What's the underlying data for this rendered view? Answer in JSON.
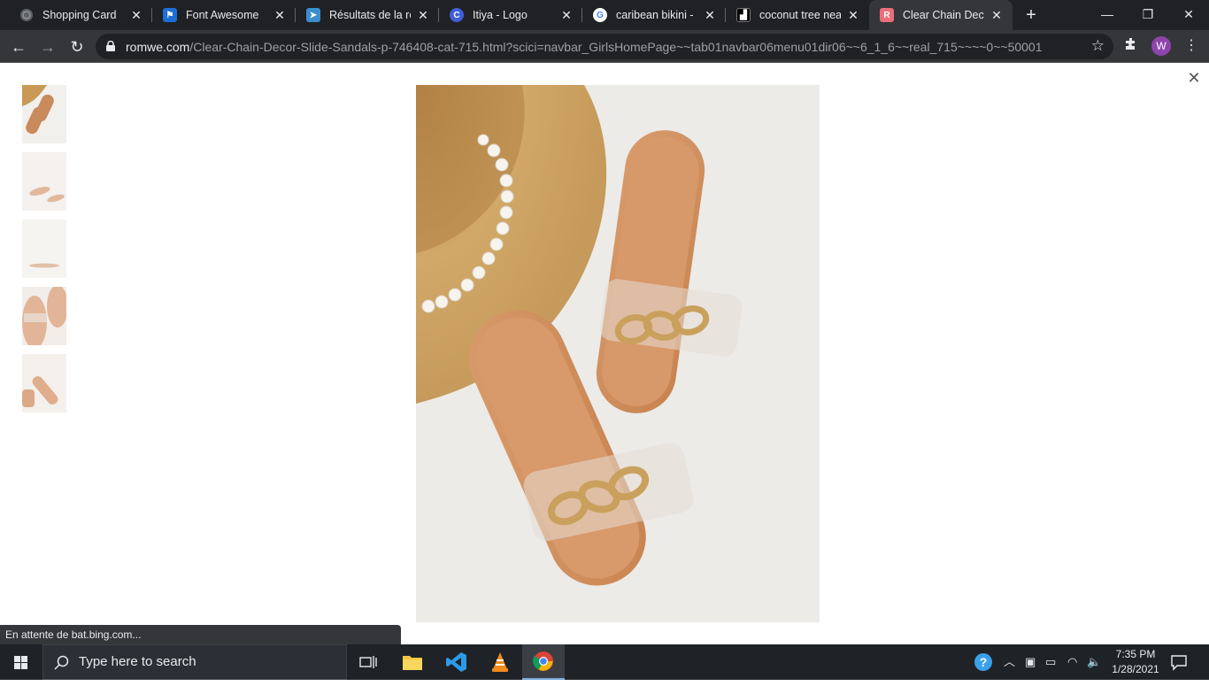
{
  "browser": {
    "tabs": [
      {
        "title": "Shopping Card",
        "icon": "globe-icon",
        "color": "#5f6368"
      },
      {
        "title": "Font Awesome",
        "icon": "flag-icon",
        "color": "#1c6ed6"
      },
      {
        "title": "Résultats de la rech",
        "icon": "bing-icon",
        "color": "#3a8ecb"
      },
      {
        "title": "Itiya - Logo",
        "icon": "canva-icon",
        "color": "#3f5fd8"
      },
      {
        "title": "caribean bikini - Re",
        "icon": "google-icon",
        "color": "#ffffff"
      },
      {
        "title": "coconut tree near",
        "icon": "site-icon",
        "color": "#000000"
      },
      {
        "title": "Clear Chain Decor",
        "icon": "romwe-icon",
        "color": "#e8707a"
      }
    ],
    "url_host": "romwe.com",
    "url_path": "/Clear-Chain-Decor-Slide-Sandals-p-746408-cat-715.html?scici=navbar_GirlsHomePage~~tab01navbar06menu01dir06~~6_1_6~~real_715~~~~0~~50001",
    "profile_initial": "W",
    "status_text": "En attente de bat.bing.com..."
  },
  "taskbar": {
    "search_placeholder": "Type here to search",
    "time": "7:35 PM",
    "date": "1/28/2021"
  }
}
